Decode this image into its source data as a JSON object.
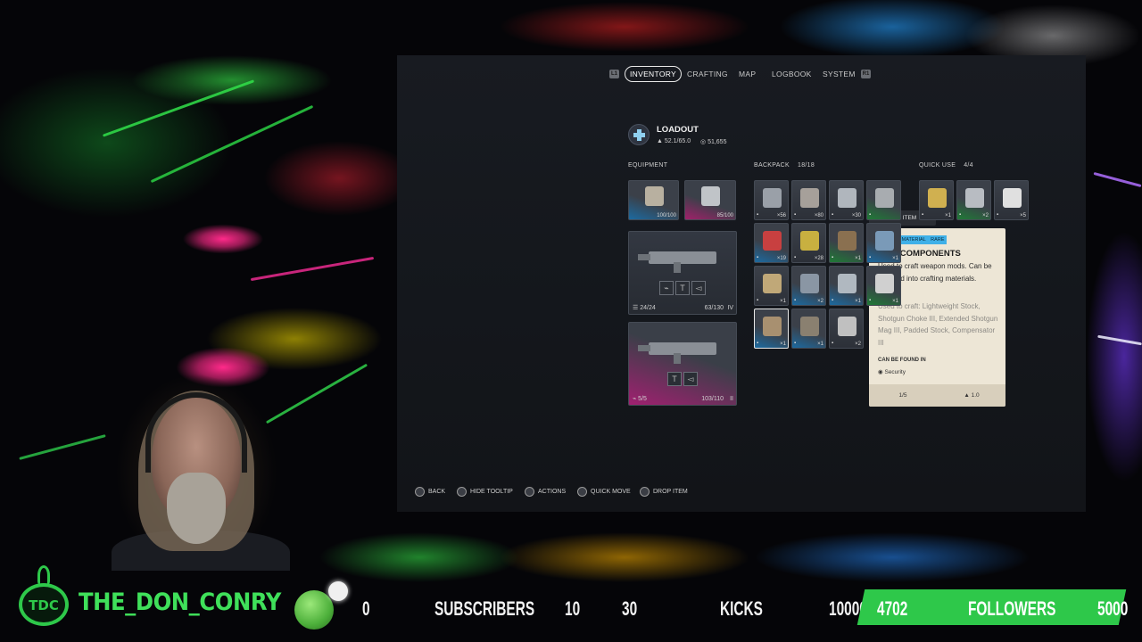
{
  "nav": {
    "left_bumper": "L1",
    "right_bumper": "R1",
    "tabs": [
      {
        "label": "INVENTORY",
        "active": true
      },
      {
        "label": "CRAFTING",
        "active": false
      },
      {
        "label": "MAP",
        "active": false
      },
      {
        "label": "LOGBOOK",
        "active": false
      },
      {
        "label": "SYSTEM",
        "active": false
      }
    ]
  },
  "loadout": {
    "title": "LOADOUT",
    "weight": "52.1/65.0",
    "currency": "51,655"
  },
  "equipment": {
    "label": "EQUIPMENT",
    "slots": [
      {
        "value": "100/100",
        "icon": "backpack-icon"
      },
      {
        "value": "85/100",
        "icon": "shield-icon"
      }
    ],
    "weapons": [
      {
        "ammo": "24/24",
        "durability": "63/130",
        "tier": "IV",
        "icon": "rifle-icon"
      },
      {
        "ammo": "5/5",
        "durability": "103/110",
        "tier": "II",
        "icon": "shotgun-icon"
      }
    ]
  },
  "backpack": {
    "label": "BACKPACK",
    "count": "18/18",
    "items": [
      {
        "qty": "×56",
        "rarity": "none",
        "icon": "ammo-icon",
        "art": "#9aa0a8"
      },
      {
        "qty": "×80",
        "rarity": "none",
        "icon": "ammo-icon",
        "art": "#a6a09a"
      },
      {
        "qty": "×30",
        "rarity": "none",
        "icon": "ammo-icon",
        "art": "#b0b6bd"
      },
      {
        "qty": "",
        "rarity": "green",
        "icon": "tool-icon",
        "art": "#a8acb0"
      },
      {
        "qty": "×19",
        "rarity": "blue",
        "icon": "medkit-icon",
        "art": "#c84040"
      },
      {
        "qty": "×28",
        "rarity": "none",
        "icon": "battery-icon",
        "art": "#c8b040"
      },
      {
        "qty": "×1",
        "rarity": "green",
        "icon": "crate-icon",
        "art": "#8a7050"
      },
      {
        "qty": "×1",
        "rarity": "blue",
        "icon": "case-icon",
        "art": "#7a9ab8"
      },
      {
        "qty": "×1",
        "rarity": "none",
        "icon": "bullet-icon",
        "art": "#c0a878"
      },
      {
        "qty": "×2",
        "rarity": "blue",
        "icon": "part-icon",
        "art": "#8a96a4"
      },
      {
        "qty": "×1",
        "rarity": "blue",
        "icon": "kit-icon",
        "art": "#b0b8c0"
      },
      {
        "qty": "×1",
        "rarity": "green",
        "icon": "cloth-icon",
        "art": "#d0d0d0"
      },
      {
        "qty": "×1",
        "rarity": "blue",
        "icon": "mod-components-icon",
        "art": "#a89070",
        "selected": true
      },
      {
        "qty": "×1",
        "rarity": "blue",
        "icon": "tube-icon",
        "art": "#8a8070"
      },
      {
        "qty": "×2",
        "rarity": "none",
        "icon": "wire-icon",
        "art": "#c0c0c0"
      }
    ]
  },
  "quick_use": {
    "label": "QUICK USE",
    "count": "4/4",
    "items": [
      {
        "qty": "×1",
        "rarity": "none",
        "icon": "duck-icon",
        "art": "#d0b050"
      },
      {
        "qty": "×2",
        "rarity": "green",
        "icon": "syringe-icon",
        "art": "#b8bcc2"
      },
      {
        "qty": "×5",
        "rarity": "none",
        "icon": "bandage-icon",
        "art": "#e0e0e0"
      }
    ]
  },
  "tooltip": {
    "ping": "PING ITEM",
    "tag": "REFINED MATERIAL",
    "rarity": "RARE",
    "title": "MOD COMPONENTS",
    "description": "Used to craft weapon mods. Can be recycled into crafting materials.",
    "crafting": "Used to craft: Lightweight Stock, Shotgun Choke III, Extended Shotgun Mag III, Padded Stock, Compensator III",
    "found_heading": "CAN BE FOUND IN",
    "found_location": "Security",
    "stack": "1/5",
    "weight": "1.0"
  },
  "prompts": [
    {
      "label": "BACK"
    },
    {
      "label": "HIDE TOOLTIP"
    },
    {
      "label": "ACTIONS"
    },
    {
      "label": "QUICK MOVE"
    },
    {
      "label": "DROP ITEM"
    }
  ],
  "stream": {
    "logo": "TDC",
    "channel": "THE_DON_CONRY",
    "subs_current": "0",
    "subs_label": "SUBSCRIBERS",
    "subs_goal": "10",
    "kicks_current": "30",
    "kicks_label": "KICKS",
    "kicks_goal": "10000",
    "followers_current": "4702",
    "followers_label": "FOLLOWERS",
    "followers_goal": "5000",
    "accent": "#2ec84a"
  }
}
